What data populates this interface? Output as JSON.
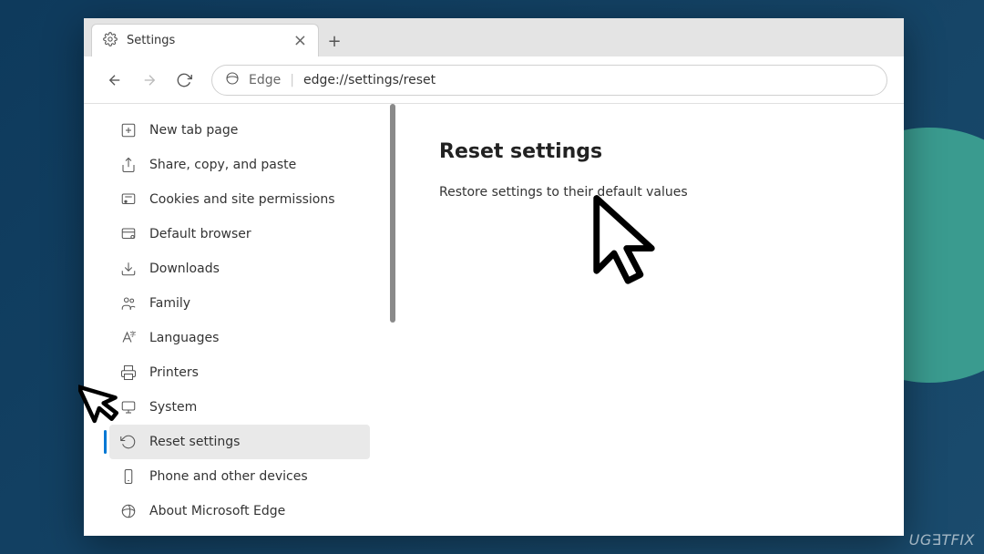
{
  "tab": {
    "title": "Settings"
  },
  "toolbar": {
    "brand": "Edge",
    "url": "edge://settings/reset"
  },
  "sidebar": {
    "items": [
      {
        "label": "New tab page",
        "icon": "plus-square-icon"
      },
      {
        "label": "Share, copy, and paste",
        "icon": "share-icon"
      },
      {
        "label": "Cookies and site permissions",
        "icon": "permissions-icon"
      },
      {
        "label": "Default browser",
        "icon": "browser-icon"
      },
      {
        "label": "Downloads",
        "icon": "download-icon"
      },
      {
        "label": "Family",
        "icon": "family-icon"
      },
      {
        "label": "Languages",
        "icon": "language-icon"
      },
      {
        "label": "Printers",
        "icon": "printer-icon"
      },
      {
        "label": "System",
        "icon": "system-icon"
      },
      {
        "label": "Reset settings",
        "icon": "reset-icon",
        "selected": true
      },
      {
        "label": "Phone and other devices",
        "icon": "phone-icon"
      },
      {
        "label": "About Microsoft Edge",
        "icon": "edge-icon"
      }
    ]
  },
  "main": {
    "heading": "Reset settings",
    "subtext": "Restore settings to their default values"
  },
  "watermark": "UG∃TFIX"
}
